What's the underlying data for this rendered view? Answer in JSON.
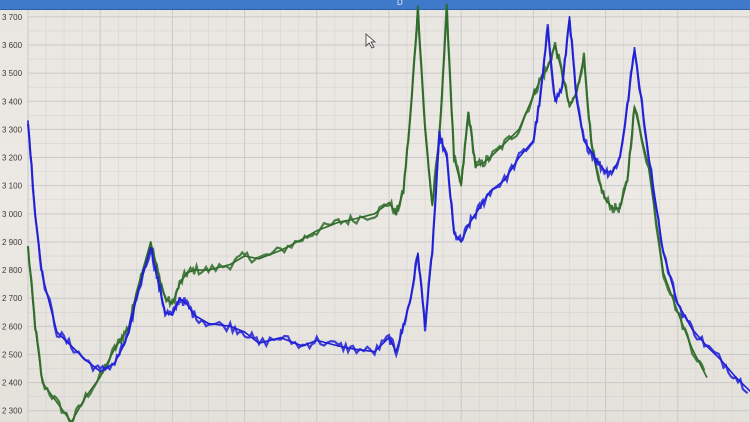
{
  "window": {
    "top_bar_label": "D"
  },
  "colors": {
    "series_green": "#2f6b2a",
    "series_blue": "#1f1fd6",
    "grid": "#c9c9c9",
    "top_bar": "#3f79c9"
  },
  "chart_data": {
    "type": "line",
    "title": "",
    "xlabel": "",
    "ylabel": "",
    "ylim": [
      2260,
      3760
    ],
    "xlim": [
      0,
      100
    ],
    "grid": true,
    "yticks": [
      {
        "value": 3700,
        "label": "3 700"
      },
      {
        "value": 3600,
        "label": "3 600"
      },
      {
        "value": 3500,
        "label": "3 500"
      },
      {
        "value": 3400,
        "label": "3 400"
      },
      {
        "value": 3300,
        "label": "3 300"
      },
      {
        "value": 3200,
        "label": "3 200"
      },
      {
        "value": 3100,
        "label": "3 100"
      },
      {
        "value": 3000,
        "label": "3 000"
      },
      {
        "value": 2900,
        "label": "2 900"
      },
      {
        "value": 2800,
        "label": "2 800"
      },
      {
        "value": 2700,
        "label": "2 700"
      },
      {
        "value": 2600,
        "label": "2 600"
      },
      {
        "value": 2500,
        "label": "2 500"
      },
      {
        "value": 2400,
        "label": "2 400"
      },
      {
        "value": 2300,
        "label": "2 300"
      }
    ],
    "series": [
      {
        "color": "#2f6b2a",
        "x": [
          0,
          1,
          2,
          4,
          6,
          8,
          10,
          12,
          13,
          14,
          15,
          17,
          18,
          19,
          20,
          21,
          22,
          23,
          25,
          28,
          30,
          32,
          35,
          38,
          40,
          43,
          45,
          48,
          50,
          51,
          52,
          53,
          54,
          55,
          56,
          57,
          58,
          59,
          60,
          61,
          62,
          63,
          64,
          66,
          68,
          70,
          71,
          72,
          73,
          74,
          75,
          76,
          77,
          78,
          79,
          80,
          81,
          82,
          83,
          84,
          86,
          88,
          90,
          92,
          94
        ],
        "y": [
          2880,
          2600,
          2400,
          2330,
          2260,
          2350,
          2420,
          2520,
          2560,
          2600,
          2720,
          2900,
          2790,
          2700,
          2680,
          2750,
          2790,
          2800,
          2800,
          2820,
          2850,
          2840,
          2870,
          2910,
          2940,
          2970,
          2980,
          3000,
          3040,
          3000,
          3080,
          3360,
          3730,
          3300,
          3030,
          3280,
          3730,
          3200,
          3100,
          3360,
          3170,
          3180,
          3200,
          3250,
          3300,
          3420,
          3480,
          3520,
          3600,
          3500,
          3380,
          3430,
          3560,
          3250,
          3120,
          3050,
          3020,
          3020,
          3120,
          3380,
          3160,
          2790,
          2650,
          2520,
          2420
        ]
      },
      {
        "color": "#1f1fd6",
        "x": [
          0,
          1,
          2,
          4,
          6,
          8,
          10,
          12,
          13,
          14,
          15,
          17,
          18,
          19,
          20,
          21,
          22,
          23,
          25,
          28,
          30,
          32,
          35,
          38,
          40,
          43,
          45,
          48,
          50,
          51,
          52,
          53,
          54,
          55,
          56,
          57,
          58,
          59,
          60,
          61,
          62,
          63,
          64,
          66,
          68,
          70,
          71,
          72,
          73,
          74,
          75,
          76,
          77,
          78,
          79,
          80,
          81,
          82,
          83,
          84,
          86,
          88,
          90,
          92,
          94,
          96,
          98,
          100
        ],
        "y": [
          3330,
          3000,
          2780,
          2580,
          2530,
          2480,
          2440,
          2470,
          2520,
          2580,
          2700,
          2880,
          2760,
          2650,
          2640,
          2700,
          2680,
          2640,
          2610,
          2600,
          2580,
          2540,
          2560,
          2530,
          2550,
          2530,
          2520,
          2510,
          2560,
          2510,
          2600,
          2700,
          2860,
          2600,
          2870,
          3280,
          3200,
          2930,
          2900,
          2960,
          3000,
          3040,
          3080,
          3120,
          3200,
          3260,
          3420,
          3660,
          3400,
          3450,
          3700,
          3400,
          3260,
          3220,
          3180,
          3150,
          3150,
          3200,
          3380,
          3590,
          3200,
          2860,
          2680,
          2590,
          2530,
          2480,
          2420,
          2370
        ]
      }
    ]
  }
}
